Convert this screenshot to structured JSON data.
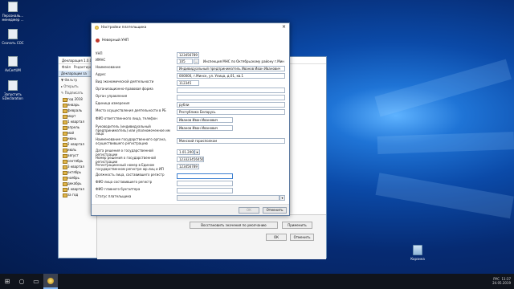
{
  "desktop": {
    "icons": [
      {
        "label": "Персональ... менеджер ..."
      },
      {
        "label": "Скачать СОС"
      },
      {
        "label": "AvCertUM"
      },
      {
        "label": "Запустить EDeclaration"
      }
    ],
    "recycle_label": "Корзина"
  },
  "bg_window": {
    "title": "Декларация 1.0.0.0",
    "menu": [
      "Файл",
      "Редактирование"
    ],
    "panel_header": "Декларации за",
    "toolbar": [
      "Фильтр",
      "Открыть",
      "Подписать"
    ],
    "tree": [
      "год 2018",
      "январь",
      "февраль",
      "март",
      "1 квартал",
      "апрель",
      "май",
      "июнь",
      "2 квартал",
      "июль",
      "август",
      "сентябрь",
      "3 квартал",
      "октябрь",
      "ноябрь",
      "декабрь",
      "4 квартал",
      "за год"
    ],
    "restore_defaults_label": "Восстановить значения по умолчанию",
    "apply_label": "Применить",
    "ok_label": "ОК",
    "cancel_label": "Отменить"
  },
  "dialog": {
    "title": "Настройки плательщика",
    "mode_label": "Неверный УНП",
    "fields": {
      "unp": {
        "label": "УНП",
        "value": "123456789"
      },
      "imns_code": {
        "label": "ИМНС",
        "value": "105"
      },
      "imns_name": {
        "value": "Инспекция МНС по Октябрьскому району г.Минска"
      },
      "name": {
        "label": "Наименование",
        "value": "Индивидуальный предприниматель Иванов Иван Иванович"
      },
      "address": {
        "label": "Адрес",
        "value": "000000, г.Минск, ул. Улица, д.01, кв.1"
      },
      "activity": {
        "label": "Вид экономической деятельности",
        "value": "112345"
      },
      "legal_form": {
        "label": "Организационно-правовая форма",
        "value": ""
      },
      "gov_body": {
        "label": "Орган управления",
        "value": ""
      },
      "unit": {
        "label": "Единица измерения",
        "value": "рубли"
      },
      "location": {
        "label": "Место осуществления деятельности в РБ",
        "value": "Республика Беларусь"
      },
      "responsible": {
        "label": "ФИО ответственного лица, телефон",
        "value": "Иванов Иван Иванович"
      },
      "manager": {
        "label": "Руководитель (индивидуальный предприниматель) или уполномоченное им лицо",
        "value": "Иванов Иван Иванович"
      },
      "reg_body": {
        "label": "Наименование государственного органа, осуществившего регистрацию",
        "value": "Минский горисполком"
      },
      "reg_date": {
        "label": "Дата решения о государственной регистрации",
        "value": "1.01.2000"
      },
      "reg_number": {
        "label": "Номер решения о государственной регистрации",
        "value": "123323456456"
      },
      "reg_record": {
        "label": "Регистрационный номер в Едином государственном регистре юр.лиц и ИП",
        "value": "123456789"
      },
      "position": {
        "label": "Должность лица, составившего регистр",
        "value": ""
      },
      "compiler": {
        "label": "ФИО лица составившего регистр",
        "value": ""
      },
      "accountant": {
        "label": "ФИО главного бухгалтера",
        "value": ""
      },
      "status": {
        "label": "Статус плательщика",
        "value": ""
      }
    },
    "ok_label": "ОК",
    "cancel_label": "Отменить"
  },
  "taskbar": {
    "time": "11:37",
    "date": "24.05.2019",
    "lang": "РУС"
  }
}
